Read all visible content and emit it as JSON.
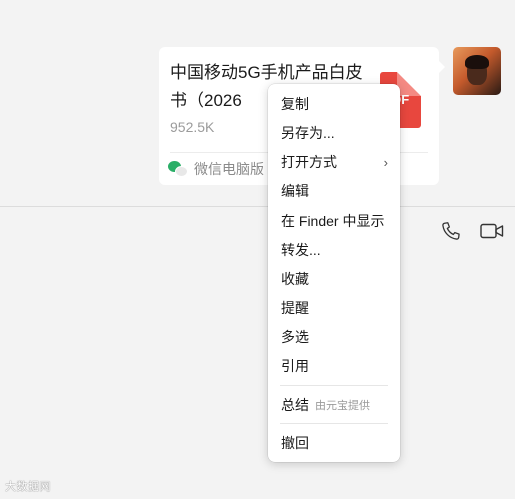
{
  "message": {
    "file_title": "中国移动5G手机产品白皮书（2026",
    "file_size": "952.5K",
    "file_type_label": "DF",
    "source_label": "微信电脑版",
    "icons": {
      "file": "pdf-icon",
      "source": "wechat-icon"
    }
  },
  "toolbar": {
    "icons": [
      "phone-icon",
      "video-call-icon"
    ]
  },
  "context_menu": {
    "items": [
      {
        "label": "复制"
      },
      {
        "label": "另存为..."
      },
      {
        "label": "打开方式",
        "has_submenu": true,
        "chevron": "›"
      },
      {
        "label": "编辑"
      },
      {
        "label": "在 Finder 中显示"
      },
      {
        "label": "转发..."
      },
      {
        "label": "收藏"
      },
      {
        "label": "提醒"
      },
      {
        "label": "多选"
      },
      {
        "label": "引用"
      },
      {
        "label": "总结",
        "sub_label": "由元宝提供"
      },
      {
        "label": "撤回"
      }
    ]
  },
  "watermark": {
    "text": "大数据网"
  },
  "colors": {
    "accent_pdf": "#e8473e",
    "wechat_green": "#2aae67",
    "background": "#f3f3f3"
  }
}
